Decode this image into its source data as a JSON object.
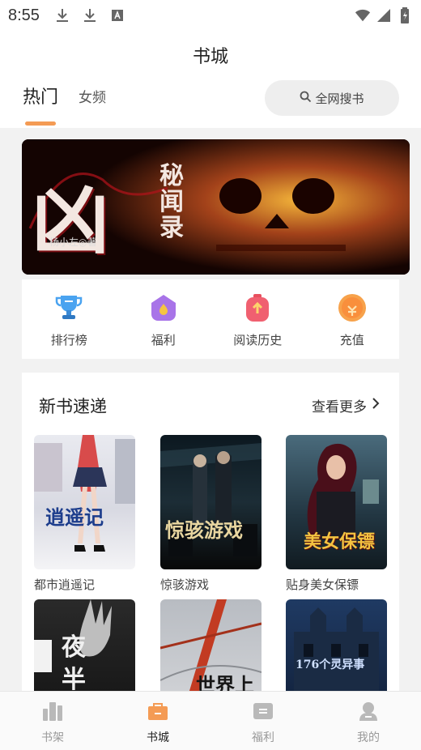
{
  "status_bar": {
    "time": "8:55"
  },
  "header": {
    "title": "书城",
    "tabs": [
      {
        "label": "热门"
      },
      {
        "label": "女频"
      }
    ],
    "search": {
      "label": "全网搜书"
    }
  },
  "banner": {
    "title_main": "凶",
    "title_side": "秘闻录",
    "author": "杨小左◎著"
  },
  "quick_menu": [
    {
      "label": "排行榜",
      "icon": "trophy-icon"
    },
    {
      "label": "福利",
      "icon": "gift-icon"
    },
    {
      "label": "阅读历史",
      "icon": "history-icon"
    },
    {
      "label": "充值",
      "icon": "coin-icon"
    }
  ],
  "new_books": {
    "title": "新书速递",
    "see_more": "查看更多",
    "books": [
      {
        "title": "都市逍遥记",
        "cover_text": "逍遥记"
      },
      {
        "title": "惊骇游戏",
        "cover_text": "惊骇游戏"
      },
      {
        "title": "贴身美女保镖",
        "cover_text": "美女保镖"
      },
      {
        "title": "",
        "cover_text": "夜半"
      },
      {
        "title": "",
        "cover_text": "世界上"
      },
      {
        "title": "",
        "cover_text": "176个灵异事"
      }
    ]
  },
  "bottom_nav": [
    {
      "label": "书架",
      "icon": "bookshelf-icon"
    },
    {
      "label": "书城",
      "icon": "bookstore-icon",
      "active": true
    },
    {
      "label": "福利",
      "icon": "welfare-icon"
    },
    {
      "label": "我的",
      "icon": "profile-icon"
    }
  ],
  "colors": {
    "accent": "#f49b54"
  }
}
